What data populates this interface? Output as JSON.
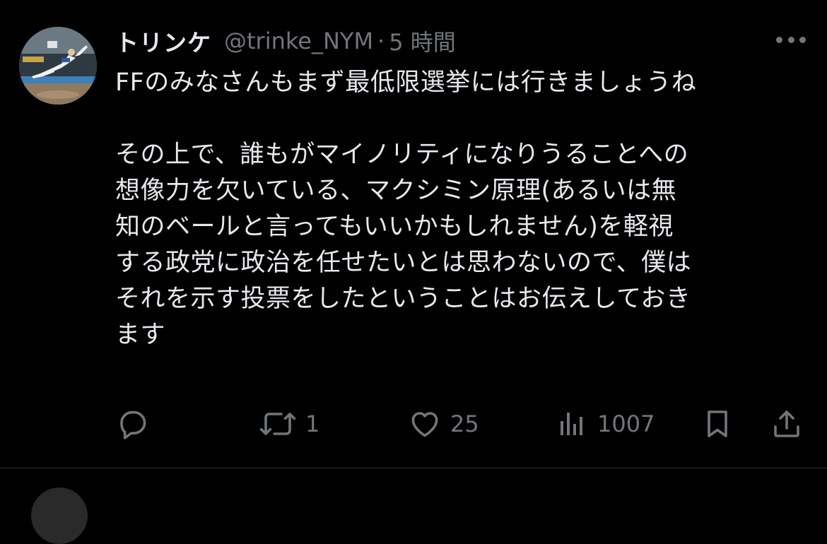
{
  "tweet": {
    "author_name": "トリンケ",
    "handle": "@trinke_NYM",
    "separator": "·",
    "time": "5 時間",
    "text_lines": [
      "FFのみなさんもまず最低限選挙には行きましょうね",
      "",
      "その上で、誰もがマイノリティになりうることへの",
      "想像力を欠いている、マクシミン原理(あるいは無",
      "知のベールと言ってもいいかもしれません)を軽視",
      "する政党に政治を任せたいとは思わないので、僕は",
      "それを示す投票をしたということはお伝えしておき",
      "ます"
    ],
    "actions": {
      "reply": {
        "icon": "reply-icon",
        "count": ""
      },
      "retweet": {
        "icon": "retweet-icon",
        "count": "1"
      },
      "like": {
        "icon": "heart-icon",
        "count": "25"
      },
      "views": {
        "icon": "views-icon",
        "count": "1007"
      },
      "bookmark": {
        "icon": "bookmark-icon"
      },
      "share": {
        "icon": "share-icon"
      }
    }
  },
  "colors": {
    "background": "#000000",
    "text": "#e7e9ea",
    "muted": "#71767b",
    "divider": "#2f3336"
  }
}
